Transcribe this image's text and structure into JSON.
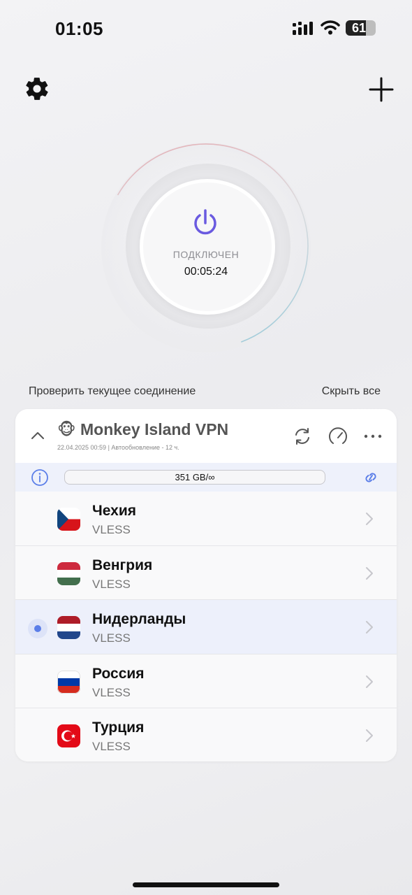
{
  "status_bar": {
    "time": "01:05",
    "battery_percent": "61"
  },
  "colors": {
    "accent": "#6a5ae0",
    "selected_dot": "#5b7ee8",
    "row_selected_bg": "#edf0fb"
  },
  "icons": {
    "settings": "gear-icon",
    "add": "plus-icon",
    "power": "power-icon",
    "collapse": "chevron-up-icon",
    "refresh": "refresh-icon",
    "speed": "speedometer-icon",
    "more": "more-icon",
    "info": "info-icon",
    "link": "link-icon",
    "row_arrow": "chevron-right-icon"
  },
  "connection": {
    "status": "ПОДКЛЮЧЕН",
    "duration": "00:05:24"
  },
  "actions": {
    "check_connection": "Проверить текущее соединение",
    "hide_all": "Скрыть все"
  },
  "subscription": {
    "emoji": "🐵",
    "name": "Monkey Island VPN",
    "meta": "22.04.2025 00:59  |  Автообновление - 12 ч.",
    "traffic": "351 GB/∞"
  },
  "servers": [
    {
      "name": "Чехия",
      "protocol": "VLESS",
      "flag": "cz",
      "selected": false
    },
    {
      "name": "Венгрия",
      "protocol": "VLESS",
      "flag": "hu",
      "selected": false
    },
    {
      "name": "Нидерланды",
      "protocol": "VLESS",
      "flag": "nl",
      "selected": true
    },
    {
      "name": "Россия",
      "protocol": "VLESS",
      "flag": "ru",
      "selected": false
    },
    {
      "name": "Турция",
      "protocol": "VLESS",
      "flag": "tr",
      "selected": false
    }
  ]
}
